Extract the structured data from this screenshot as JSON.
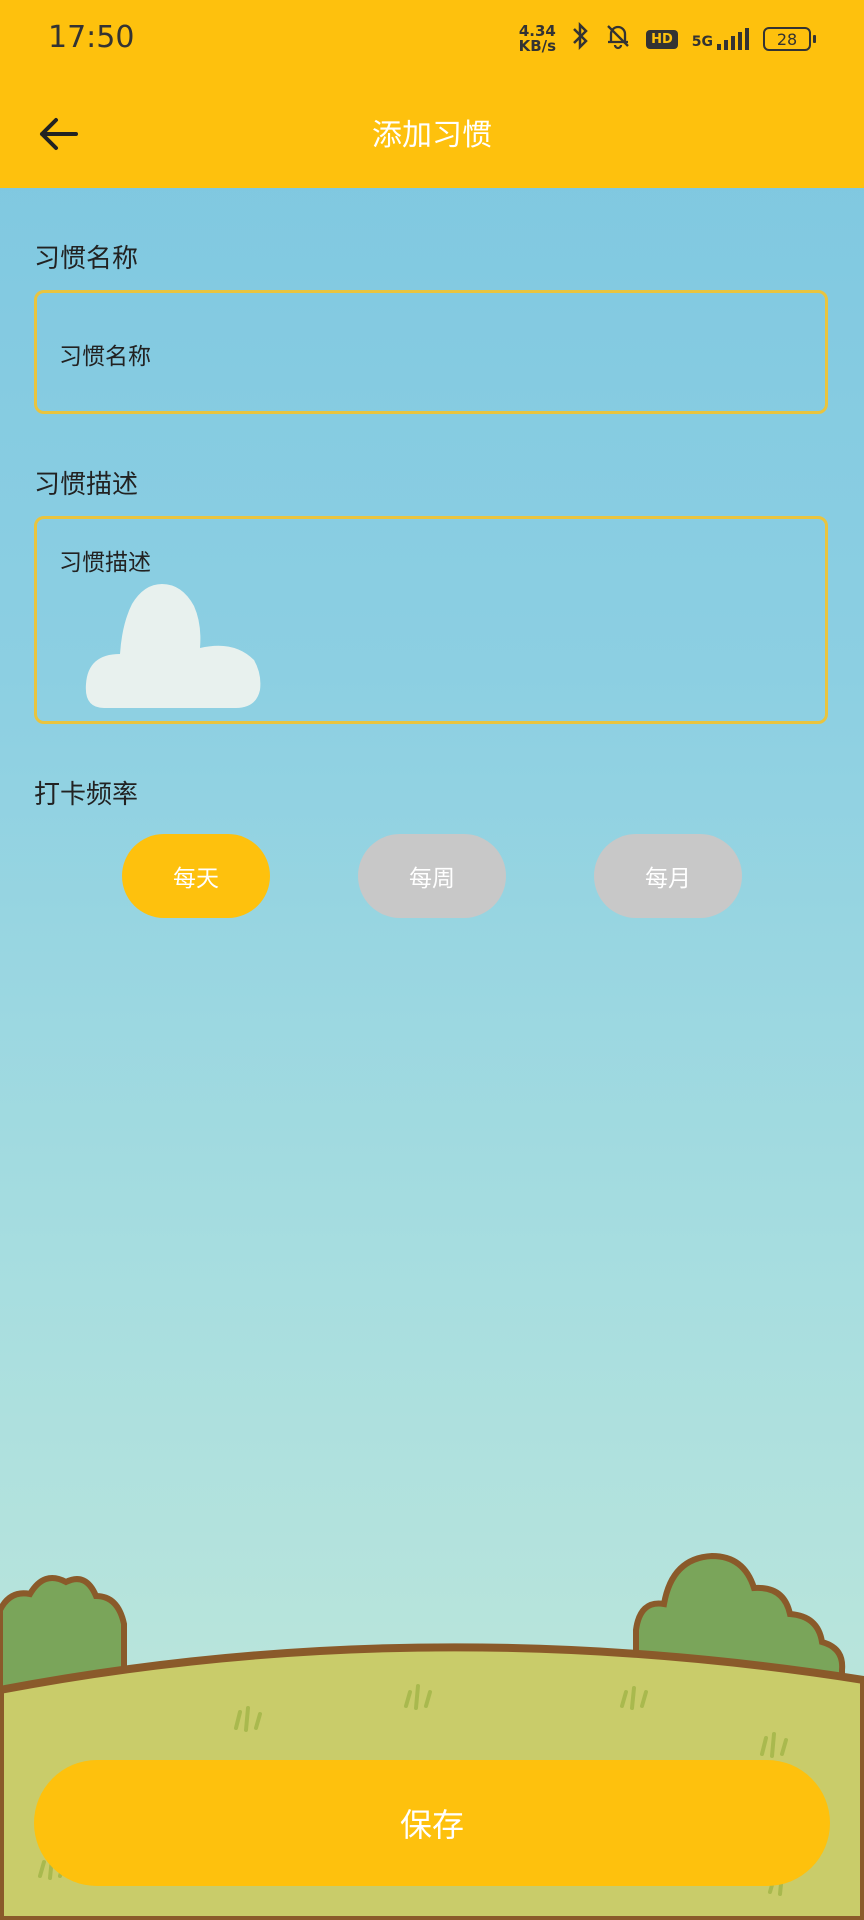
{
  "status_bar": {
    "time": "17:50",
    "net_speed_value": "4.34",
    "net_speed_unit": "KB/s",
    "hd_label": "HD",
    "network_label": "5G",
    "battery_level": "28"
  },
  "header": {
    "title": "添加习惯",
    "back_icon": "arrow-left-icon"
  },
  "form": {
    "name_label": "习惯名称",
    "name_placeholder": "习惯名称",
    "description_label": "习惯描述",
    "description_placeholder": "习惯描述",
    "frequency_label": "打卡频率",
    "frequency_options": [
      {
        "label": "每天",
        "selected": true
      },
      {
        "label": "每周",
        "selected": false
      },
      {
        "label": "每月",
        "selected": false
      }
    ]
  },
  "actions": {
    "save_label": "保存"
  },
  "colors": {
    "accent": "#fec10d",
    "unselected": "#c8c8c8",
    "input_border": "#e9c43e"
  }
}
